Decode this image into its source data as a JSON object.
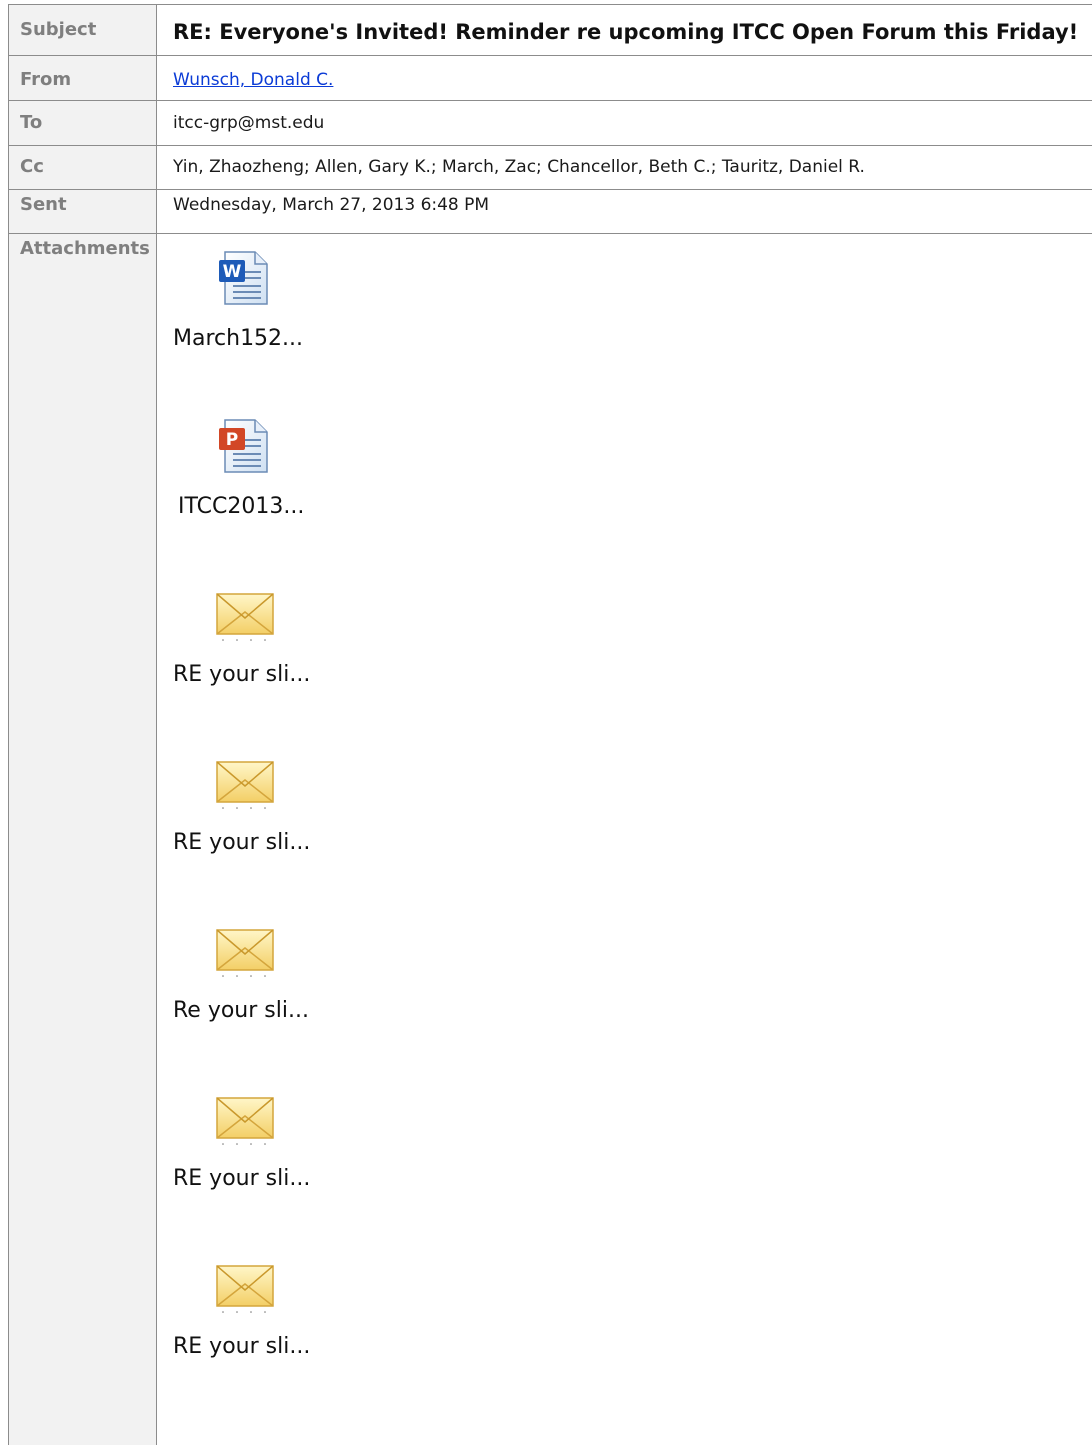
{
  "fields": {
    "subject_label": "Subject",
    "subject": "RE: Everyone's Invited!  Reminder re upcoming ITCC Open Forum this Friday!",
    "from_label": "From",
    "from": "Wunsch, Donald C.",
    "to_label": "To",
    "to": "itcc-grp@mst.edu",
    "cc_label": "Cc",
    "cc": "Yin, Zhaozheng; Allen, Gary K.; March, Zac; Chancellor, Beth C.; Tauritz, Daniel R.",
    "sent_label": "Sent",
    "sent": "Wednesday, March 27, 2013 6:48 PM",
    "attachments_label": "Attachments"
  },
  "attachments": [
    {
      "name": "March152...",
      "icon": "word-document-icon"
    },
    {
      "name": "ITCC2013...",
      "icon": "powerpoint-document-icon"
    },
    {
      "name": "RE your sli...",
      "icon": "email-message-icon"
    },
    {
      "name": "RE your sli...",
      "icon": "email-message-icon"
    },
    {
      "name": "Re your sli...",
      "icon": "email-message-icon"
    },
    {
      "name": "RE your sli...",
      "icon": "email-message-icon"
    },
    {
      "name": "RE your sli...",
      "icon": "email-message-icon"
    }
  ],
  "colors": {
    "label_bg": "#f2f2f2",
    "label_text": "#7f7f7f",
    "border": "#8c8c8c",
    "link": "#0b3bd6"
  }
}
